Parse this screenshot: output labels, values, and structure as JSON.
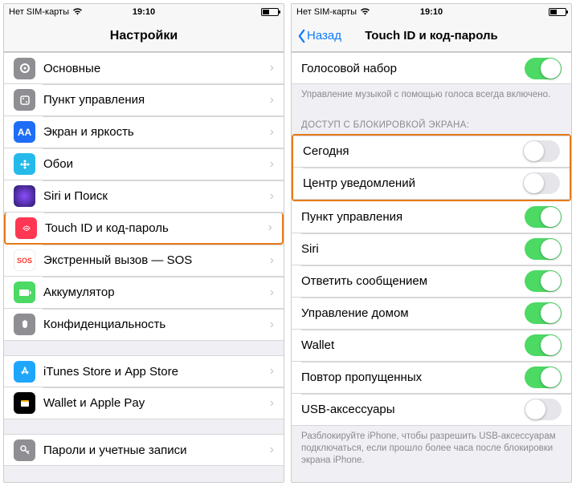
{
  "status": {
    "carrier": "Нет SIM-карты",
    "time": "19:10"
  },
  "left": {
    "title": "Настройки",
    "g1": [
      {
        "label": "Основные"
      },
      {
        "label": "Пункт управления"
      },
      {
        "label": "Экран и яркость"
      },
      {
        "label": "Обои"
      },
      {
        "label": "Siri и Поиск"
      },
      {
        "label": "Touch ID и код-пароль"
      },
      {
        "label": "Экстренный вызов — SOS"
      },
      {
        "label": "Аккумулятор"
      },
      {
        "label": "Конфиденциальность"
      }
    ],
    "g2": [
      {
        "label": "iTunes Store и App Store"
      },
      {
        "label": "Wallet и Apple Pay"
      }
    ],
    "g3": [
      {
        "label": "Пароли и учетные записи"
      }
    ]
  },
  "right": {
    "back": "Назад",
    "title": "Touch ID и код-пароль",
    "voice": {
      "label": "Голосовой набор",
      "on": true
    },
    "voice_footer": "Управление музыкой с помощью голоса всегда включено.",
    "lock_header": "ДОСТУП С БЛОКИРОВКОЙ ЭКРАНА:",
    "items": [
      {
        "label": "Сегодня",
        "on": false
      },
      {
        "label": "Центр уведомлений",
        "on": false
      },
      {
        "label": "Пункт управления",
        "on": true
      },
      {
        "label": "Siri",
        "on": true
      },
      {
        "label": "Ответить сообщением",
        "on": true
      },
      {
        "label": "Управление домом",
        "on": true
      },
      {
        "label": "Wallet",
        "on": true
      },
      {
        "label": "Повтор пропущенных",
        "on": true
      },
      {
        "label": "USB-аксессуары",
        "on": false
      }
    ],
    "usb_footer": "Разблокируйте iPhone, чтобы разрешить USB-аксессуарам подключаться, если прошло более часа после блокировки экрана iPhone."
  }
}
